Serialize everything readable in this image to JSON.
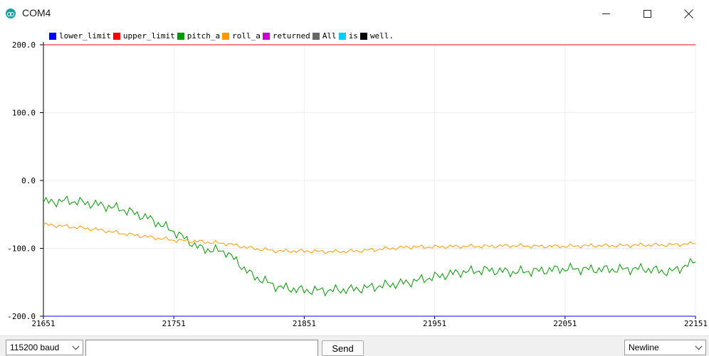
{
  "window": {
    "title": "COM4",
    "app_icon": "arduino-icon",
    "controls": [
      "minimize-icon",
      "maximize-icon",
      "close-icon"
    ]
  },
  "toolbar": {
    "baud": "115200 baud",
    "message_value": "",
    "send_label": "Send",
    "line_ending": "Newline"
  },
  "legend": [
    {
      "label": "lower_limit",
      "color": "#0000ff"
    },
    {
      "label": "upper_limit",
      "color": "#ff0000"
    },
    {
      "label": "pitch_a",
      "color": "#009900"
    },
    {
      "label": "roll_a",
      "color": "#ff9900"
    },
    {
      "label": "returned",
      "color": "#cc00cc"
    },
    {
      "label": "All",
      "color": "#666666"
    },
    {
      "label": "is",
      "color": "#00ccff"
    },
    {
      "label": "well.",
      "color": "#000000"
    }
  ],
  "chart_data": {
    "type": "line",
    "xlim": [
      21651,
      22151
    ],
    "ylim": [
      -200,
      200
    ],
    "x_ticks": [
      "21651",
      "21751",
      "21851",
      "21951",
      "22051",
      "22151"
    ],
    "y_ticks": [
      "200.0",
      "100.0",
      "0.0",
      "-100.0",
      "-200.0"
    ],
    "grid": true,
    "legend_position": "top-left",
    "x": [
      21651,
      21671,
      21691,
      21711,
      21731,
      21751,
      21771,
      21791,
      21811,
      21831,
      21851,
      21871,
      21891,
      21911,
      21931,
      21951,
      21971,
      21991,
      22011,
      22031,
      22051,
      22071,
      22091,
      22111,
      22131,
      22151
    ],
    "series": [
      {
        "name": "lower_limit",
        "color": "#0000ff",
        "values": [
          -200,
          -200,
          -200,
          -200,
          -200,
          -200,
          -200,
          -200,
          -200,
          -200,
          -200,
          -200,
          -200,
          -200,
          -200,
          -200,
          -200,
          -200,
          -200,
          -200,
          -200,
          -200,
          -200,
          -200,
          -200,
          -200
        ]
      },
      {
        "name": "upper_limit",
        "color": "#ff0000",
        "values": [
          200,
          200,
          200,
          200,
          200,
          200,
          200,
          200,
          200,
          200,
          200,
          200,
          200,
          200,
          200,
          200,
          200,
          200,
          200,
          200,
          200,
          200,
          200,
          200,
          200,
          200
        ]
      },
      {
        "name": "pitch_a",
        "color": "#009900",
        "values": [
          -32,
          -30,
          -35,
          -42,
          -55,
          -75,
          -100,
          -105,
          -140,
          -157,
          -162,
          -162,
          -160,
          -155,
          -150,
          -142,
          -135,
          -132,
          -135,
          -133,
          -130,
          -131,
          -131,
          -130,
          -135,
          -120
        ]
      },
      {
        "name": "roll_a",
        "color": "#ff9900",
        "values": [
          -65,
          -68,
          -72,
          -78,
          -83,
          -88,
          -90,
          -93,
          -100,
          -104,
          -104,
          -105,
          -104,
          -101,
          -98,
          -98,
          -97,
          -97,
          -96,
          -97,
          -97,
          -96,
          -96,
          -95,
          -95,
          -93
        ]
      }
    ]
  }
}
